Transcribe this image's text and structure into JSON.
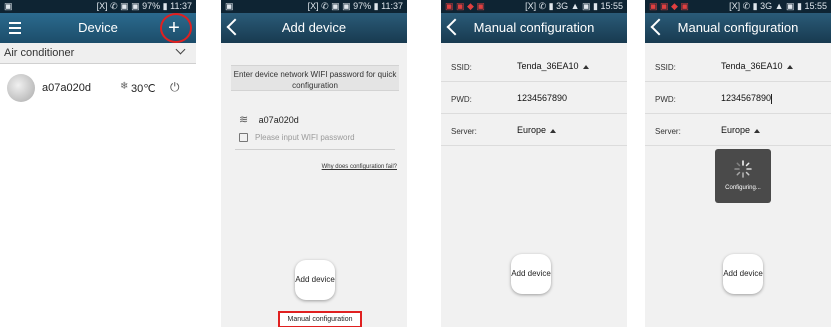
{
  "screen1": {
    "status_time": "11:37",
    "status_icons": "[X] ✆ ▣ ▣ 97% ▮",
    "title": "Device",
    "category": "Air conditioner",
    "device_name": "a07a020d",
    "temperature": "30℃"
  },
  "screen2": {
    "status_time": "11:37",
    "status_icons": "[X] ✆ ▣ ▣ 97% ▮",
    "title": "Add device",
    "instruction": "Enter device network WIFI password for quick configuration",
    "wifi_name": "a07a020d",
    "password_placeholder": "Please input WIFI password",
    "help_link": "Why does configuration fail?",
    "add_device": "Add device",
    "manual_config": "Manual configuration"
  },
  "screen3": {
    "status_time": "15:55",
    "status_icons": "[X] ✆ ▮ 3G ▲ ▣ ▮",
    "title": "Manual configuration",
    "ssid_label": "SSID:",
    "ssid_value": "Tenda_36EA10",
    "pwd_label": "PWD:",
    "pwd_value": "1234567890",
    "server_label": "Server:",
    "server_value": "Europe",
    "add_device": "Add device"
  },
  "screen4": {
    "status_time": "15:55",
    "status_icons": "[X] ✆ ▮ 3G ▲ ▣ ▮",
    "title": "Manual configuration",
    "ssid_label": "SSID:",
    "ssid_value": "Tenda_36EA10",
    "pwd_label": "PWD:",
    "pwd_value": "1234567890",
    "server_label": "Server:",
    "server_value": "Europe",
    "configuring": "Configuring...",
    "add_device": "Add device"
  },
  "colors": {
    "titlebar": "#1f4a63",
    "highlight": "#e02020"
  }
}
